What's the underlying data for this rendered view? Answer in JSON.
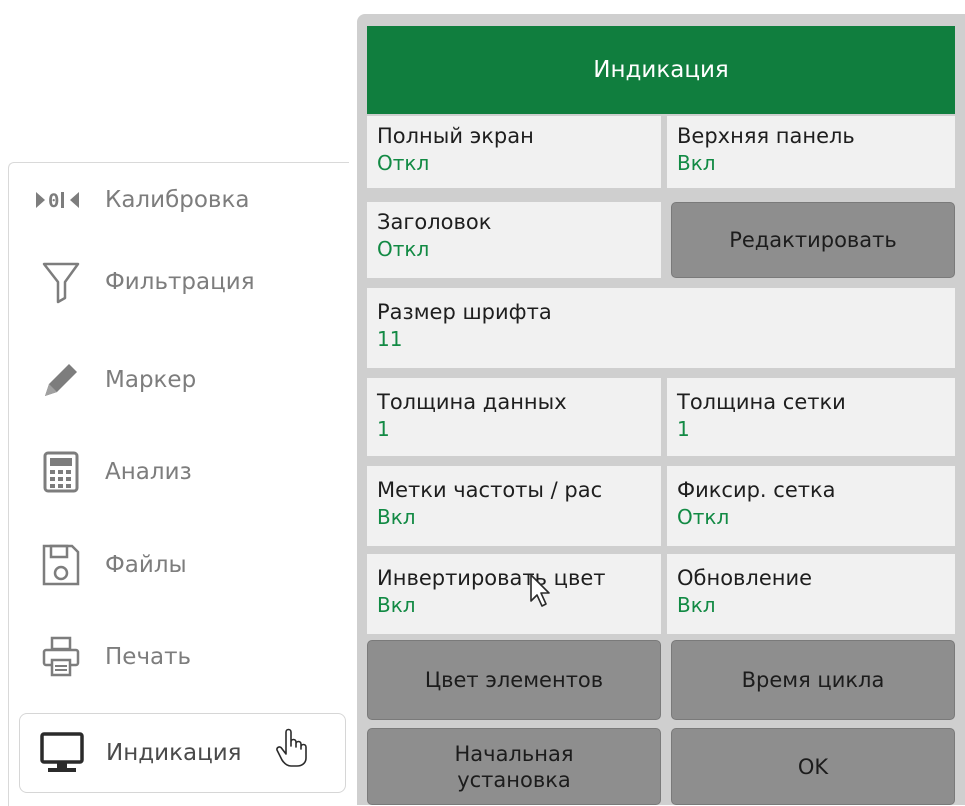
{
  "menu": {
    "items": [
      {
        "label": "Калибровка",
        "icon": "calibration-icon"
      },
      {
        "label": "Фильтрация",
        "icon": "filter-icon"
      },
      {
        "label": "Маркер",
        "icon": "pencil-icon"
      },
      {
        "label": "Анализ",
        "icon": "calculator-icon"
      },
      {
        "label": "Файлы",
        "icon": "floppy-disk-icon"
      },
      {
        "label": "Печать",
        "icon": "printer-icon"
      },
      {
        "label": "Индикация",
        "icon": "monitor-icon",
        "active": true
      }
    ]
  },
  "panel": {
    "title": "Индикация",
    "full_screen": {
      "label": "Полный экран",
      "value": "Откл"
    },
    "top_panel": {
      "label": "Верхняя панель",
      "value": "Вкл"
    },
    "header": {
      "label": "Заголовок",
      "value": "Откл"
    },
    "edit_button": "Редактировать",
    "font_size": {
      "label": "Размер шрифта",
      "value": "11"
    },
    "data_thickness": {
      "label": "Толщина данных",
      "value": "1"
    },
    "grid_thickness": {
      "label": "Толщина сетки",
      "value": "1"
    },
    "freq_labels": {
      "label": "Метки частоты / рас",
      "value": "Вкл"
    },
    "fixed_grid": {
      "label": "Фиксир. сетка",
      "value": "Откл"
    },
    "invert_colors": {
      "label": "Инвертировать цвет",
      "value": "Вкл"
    },
    "update": {
      "label": "Обновление",
      "value": "Вкл"
    },
    "element_color_button": "Цвет элементов",
    "cycle_time_button": "Время цикла",
    "initial_setup_button_line1": "Начальная",
    "initial_setup_button_line2": "установка",
    "ok_button": "OK"
  },
  "colors": {
    "header_bg": "#107e3e",
    "value_text": "#128a44",
    "button_bg": "#8e8e8e",
    "cell_bg": "#f1f1f1",
    "panel_bg": "#cfcfcf"
  }
}
